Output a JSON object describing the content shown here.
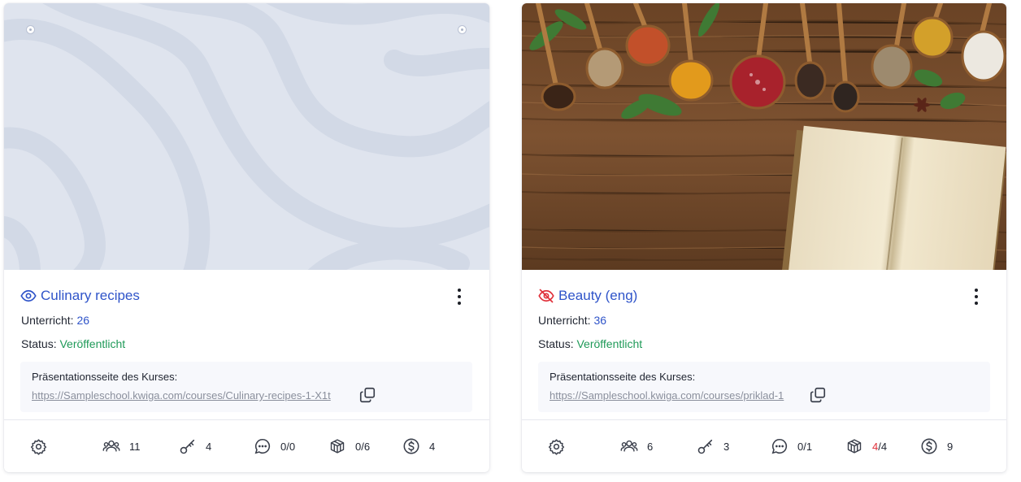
{
  "courses": [
    {
      "title": "Culinary recipes",
      "visibility_icon": "eye-icon",
      "lessons_label": "Unterricht:",
      "lessons_value": "26",
      "status_label": "Status:",
      "status_value": "Veröffentlicht",
      "presentation_label": "Präsentationsseite des Kurses:",
      "presentation_url": "https://Sampleschool.kwiga.com/courses/Culinary-recipes-1-X1t",
      "stats": {
        "students": "11",
        "access_keys": "4",
        "comments": "0/0",
        "modules": "0/6",
        "payments": "4"
      }
    },
    {
      "title": "Beauty (eng)",
      "visibility_icon": "eye-off-icon",
      "lessons_label": "Unterricht:",
      "lessons_value": "36",
      "status_label": "Status:",
      "status_value": "Veröffentlicht",
      "presentation_label": "Präsentationsseite des Kurses:",
      "presentation_url": "https://Sampleschool.kwiga.com/courses/priklad-1",
      "stats": {
        "students": "6",
        "access_keys": "3",
        "comments": "0/1",
        "modules_done": "4",
        "modules_total": "/4",
        "payments": "9"
      }
    }
  ],
  "colors": {
    "title_blue": "#2f54c9",
    "status_green": "#1f9a58",
    "hidden_red": "#e0303a",
    "placeholder_cover": "#dde3ee"
  }
}
